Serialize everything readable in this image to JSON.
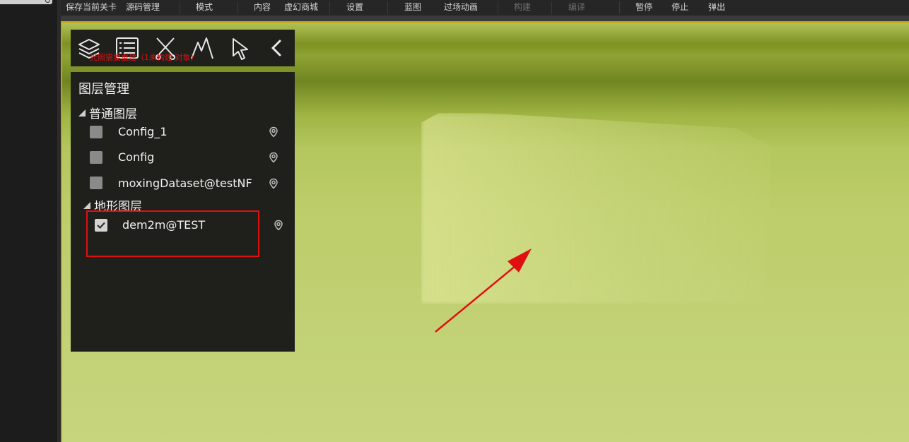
{
  "toolbar": {
    "items": [
      {
        "label": "保存当前关卡"
      },
      {
        "label": "源码管理"
      },
      {
        "label": "模式"
      },
      {
        "label": "内容"
      },
      {
        "label": "虚幻商城"
      },
      {
        "label": "设置"
      },
      {
        "label": "蓝图"
      },
      {
        "label": "过场动画"
      },
      {
        "label": "构建"
      },
      {
        "label": "编译"
      },
      {
        "label": "暂停"
      },
      {
        "label": "停止"
      },
      {
        "label": "弹出"
      }
    ]
  },
  "viewport": {
    "hint_text": "光照需要重建（1未构建 对象）"
  },
  "panel_tools": [
    "layers-icon",
    "list-icon",
    "scissors-icon",
    "terrain-icon",
    "cursor-icon",
    "chevron-left-icon"
  ],
  "layer_panel": {
    "title": "图层管理",
    "groups": [
      {
        "name": "普通图层",
        "layers": [
          {
            "name": "Config_1",
            "checked": false
          },
          {
            "name": "Config",
            "checked": false
          },
          {
            "name": "moxingDataset@testNF",
            "checked": false
          }
        ]
      },
      {
        "name": "地形图层",
        "layers": [
          {
            "name": "dem2m@TEST",
            "checked": true
          }
        ]
      }
    ]
  },
  "colors": {
    "annotation_red": "#e01010",
    "panel_bg": "#1f1f1b",
    "terrain_green": "#b4c65e"
  }
}
